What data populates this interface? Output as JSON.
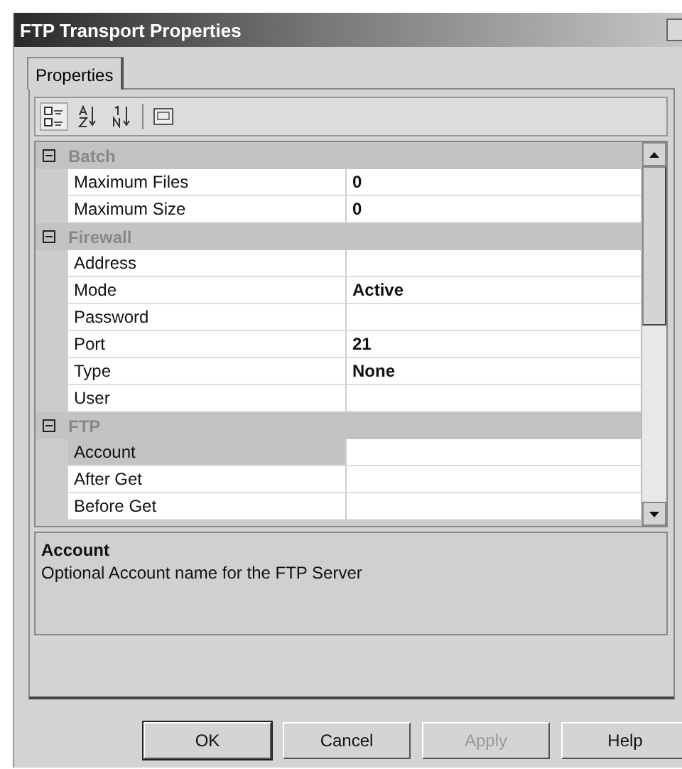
{
  "window": {
    "title": "FTP Transport Properties"
  },
  "tabs": [
    {
      "label": "Properties",
      "selected": true
    }
  ],
  "toolbar": [
    {
      "kind": "categorized",
      "selected": true
    },
    {
      "kind": "alphabetical",
      "selected": false
    },
    {
      "kind": "numeric",
      "selected": false
    },
    {
      "kind": "pages",
      "selected": false
    }
  ],
  "grid": {
    "categories": [
      {
        "name": "Batch",
        "expanded": true,
        "children": [
          {
            "name": "Maximum Files",
            "value": "0",
            "selected": false
          },
          {
            "name": "Maximum Size",
            "value": "0",
            "selected": false
          }
        ]
      },
      {
        "name": "Firewall",
        "expanded": true,
        "children": [
          {
            "name": "Address",
            "selected": false
          },
          {
            "name": "Mode",
            "value": "Active",
            "selected": false
          },
          {
            "name": "Password",
            "selected": false
          },
          {
            "name": "Port",
            "value": "21",
            "selected": false
          },
          {
            "name": "Type",
            "value": "None",
            "selected": false
          },
          {
            "name": "User",
            "selected": false
          }
        ]
      },
      {
        "name": "FTP",
        "expanded": true,
        "children": [
          {
            "name": "Account",
            "selected": true
          },
          {
            "name": "After Get",
            "selected": false
          },
          {
            "name": "Before Get",
            "selected": false
          }
        ]
      }
    ]
  },
  "description": {
    "title": "Account",
    "text": "Optional Account name for the FTP Server"
  },
  "buttons": [
    {
      "label": "OK",
      "disabled": false,
      "default": true
    },
    {
      "label": "Cancel",
      "disabled": false,
      "default": false
    },
    {
      "label": "Apply",
      "disabled": true,
      "default": false
    },
    {
      "label": "Help",
      "disabled": false,
      "default": false
    }
  ]
}
